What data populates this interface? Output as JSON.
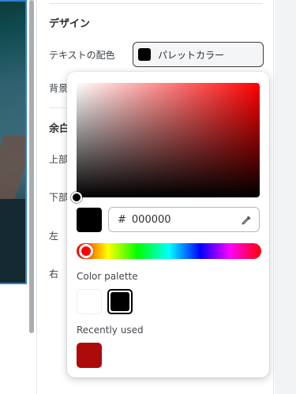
{
  "panel": {
    "design_title": "デザイン",
    "text_color_label": "テキストの配色",
    "text_color_value": "パレットカラー",
    "background_label": "背景",
    "margin_title": "余白",
    "top_label": "上部",
    "bottom_label": "下部",
    "left_label": "左",
    "right_label": "右"
  },
  "picker": {
    "hash": "#",
    "hex_value": "000000",
    "palette_label": "Color palette",
    "recent_label": "Recently used",
    "selected_color": "#000000",
    "palette_colors": [
      "#ffffff",
      "#000000"
    ],
    "recent_colors": [
      "#ad0a0a"
    ],
    "hue_color": "#ff0000"
  },
  "icons": {
    "eyedropper": "eyedropper-icon"
  }
}
